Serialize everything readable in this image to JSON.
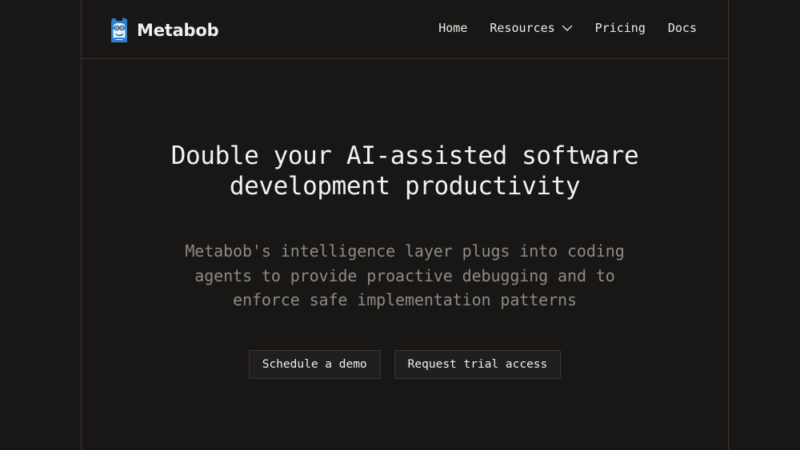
{
  "brand": {
    "name": "Metabob",
    "logo_icon": "metabob-robot-face-icon",
    "logo_colors": {
      "outline": "#2f7fcf",
      "face": "#e8f2fb",
      "eyes": "#1b4f8a"
    }
  },
  "nav": {
    "home": "Home",
    "resources": "Resources",
    "resources_icon": "chevron-down-icon",
    "pricing": "Pricing",
    "docs": "Docs"
  },
  "hero": {
    "title_line1": "Double your AI-assisted software",
    "title_line2": "development productivity",
    "subtitle_line1": "Metabob's intelligence layer plugs into coding",
    "subtitle_line2": "agents to provide proactive debugging and to",
    "subtitle_line3": "enforce safe implementation patterns"
  },
  "cta": {
    "schedule_demo": "Schedule a demo",
    "request_trial": "Request trial access"
  },
  "theme": {
    "background": "#191716",
    "border": "#3a3735",
    "text": "#f3f2f0",
    "muted_text": "#8d8a86",
    "button_bg": "#211f1e"
  }
}
